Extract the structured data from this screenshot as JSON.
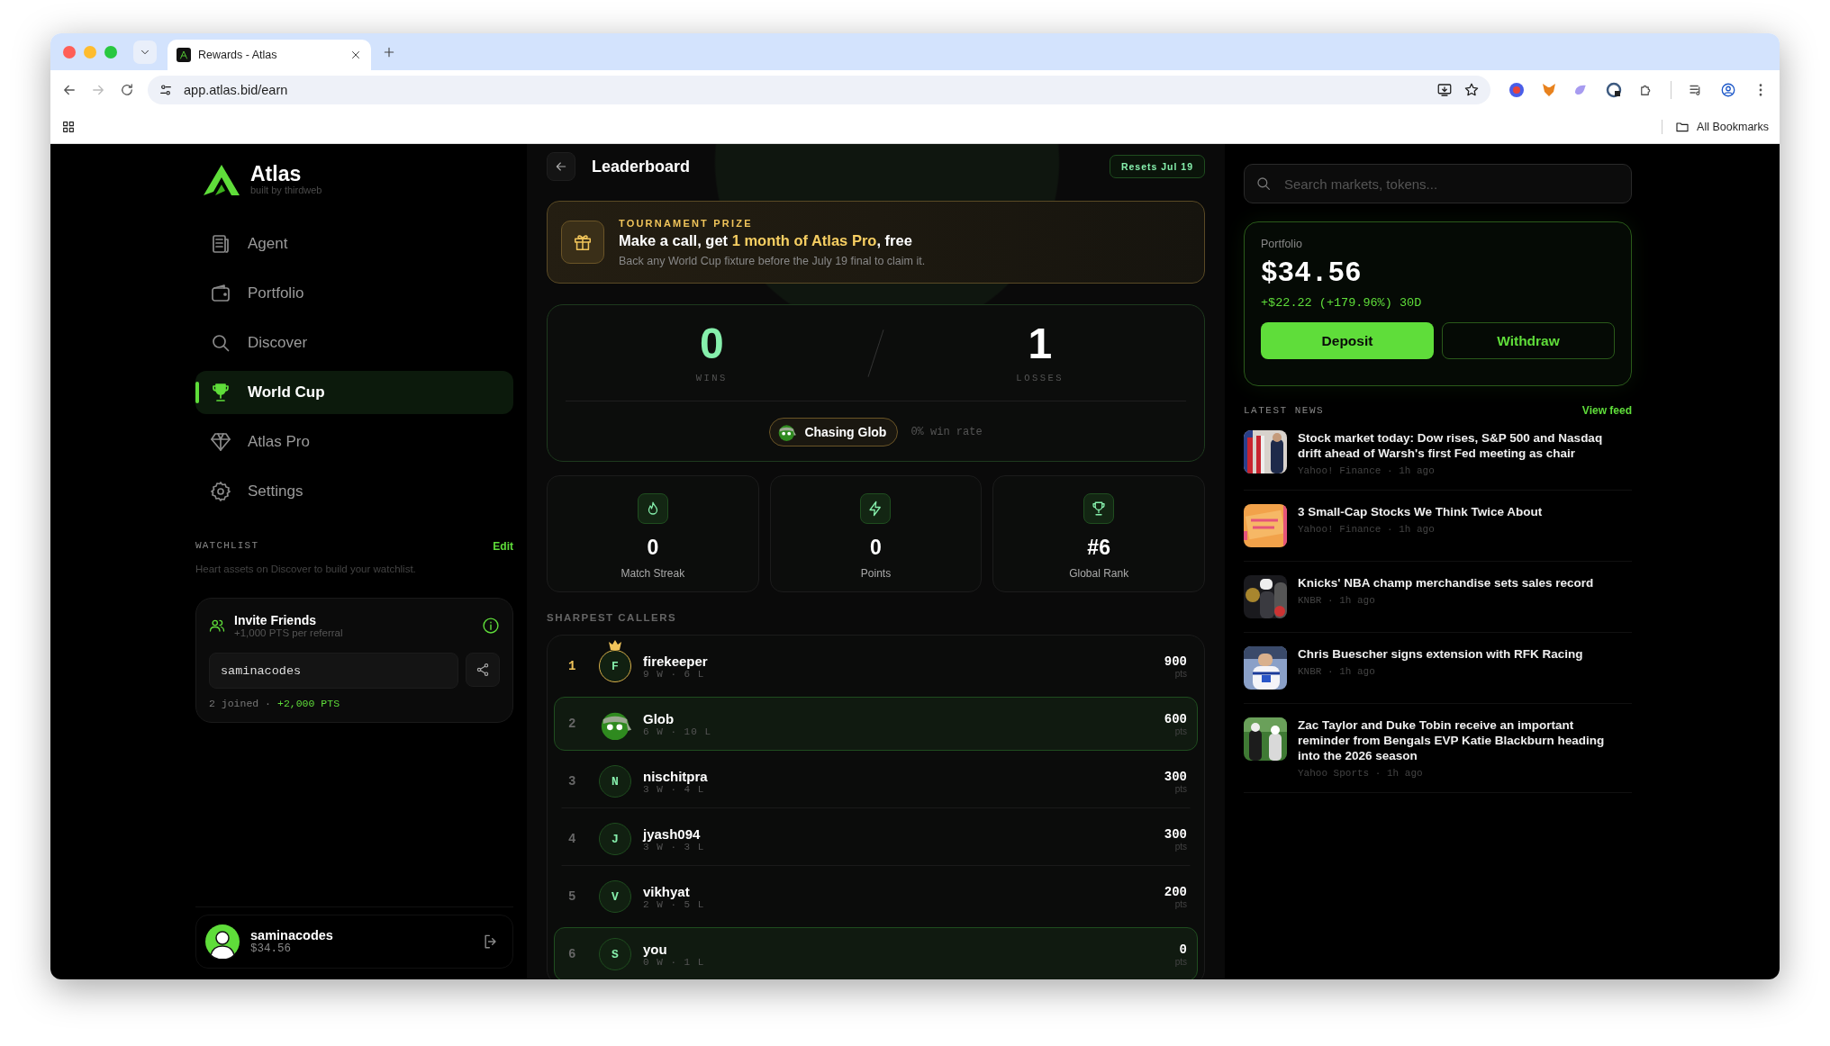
{
  "browser": {
    "tab_title": "Rewards - Atlas",
    "url": "app.atlas.bid/earn",
    "bookmarks": "All Bookmarks"
  },
  "sidebar": {
    "brand": {
      "name": "Atlas",
      "tagline": "built by thirdweb"
    },
    "nav": [
      {
        "label": "Agent",
        "kind": "agent",
        "selected": false
      },
      {
        "label": "Portfolio",
        "kind": "wallet",
        "selected": false
      },
      {
        "label": "Discover",
        "kind": "search",
        "selected": false
      },
      {
        "label": "World Cup",
        "kind": "trophy",
        "selected": true
      },
      {
        "label": "Atlas Pro",
        "kind": "diamond",
        "selected": false
      },
      {
        "label": "Settings",
        "kind": "settings",
        "selected": false
      }
    ],
    "watchlist": {
      "title": "WATCHLIST",
      "action": "Edit",
      "empty_text": "Heart assets on Discover to build your watchlist."
    },
    "invite": {
      "title": "Invite Friends",
      "subtitle": "+1,000 PTS per referral",
      "code": "saminacodes",
      "joined": "2 joined ·",
      "bonus": "+2,000 PTS"
    },
    "user": {
      "name": "saminacodes",
      "balance": "$34.56"
    }
  },
  "leaderboard": {
    "title": "Leaderboard",
    "resets": "Resets Jul 19",
    "prize": {
      "eyebrow": "TOURNAMENT PRIZE",
      "headline": "Make a call, get **1 month of Atlas Pro**, free",
      "note": "Back any World Cup fixture before the July 19 final to claim it."
    },
    "record": {
      "wins": "0",
      "wins_label": "WINS",
      "losses": "1",
      "losses_label": "LOSSES",
      "chasing": "Chasing Glob",
      "win_rate": "0% win rate"
    },
    "stats": [
      {
        "kind": "streak",
        "value": "0",
        "label": "Match Streak"
      },
      {
        "kind": "points",
        "value": "0",
        "label": "Points"
      },
      {
        "kind": "rank",
        "value": "#6",
        "label": "Global Rank"
      }
    ],
    "callers_title": "SHARPEST CALLERS",
    "callers": [
      {
        "rank": "1",
        "kind": "leader",
        "initial": "F",
        "name": "firekeeper",
        "record": "9 W · 6 L",
        "points": "900",
        "unit": "pts",
        "highlighted": false
      },
      {
        "rank": "2",
        "kind": "mascot",
        "name": "Glob",
        "record": "6 W · 10 L",
        "points": "600",
        "unit": "pts",
        "highlighted": true
      },
      {
        "rank": "3",
        "kind": "letter",
        "initial": "N",
        "name": "nischitpra",
        "record": "3 W · 4 L",
        "points": "300",
        "unit": "pts",
        "highlighted": false
      },
      {
        "rank": "4",
        "kind": "letter",
        "initial": "J",
        "name": "jyash094",
        "record": "3 W · 3 L",
        "points": "300",
        "unit": "pts",
        "highlighted": false
      },
      {
        "rank": "5",
        "kind": "letter",
        "initial": "V",
        "name": "vikhyat",
        "record": "2 W · 5 L",
        "points": "200",
        "unit": "pts",
        "highlighted": false
      },
      {
        "rank": "6",
        "kind": "letter",
        "initial": "S",
        "name": "you",
        "record": "0 W · 1 L",
        "points": "0",
        "unit": "pts",
        "highlighted": true
      }
    ]
  },
  "right": {
    "search": {
      "placeholder": "Search markets, tokens..."
    },
    "portfolio": {
      "label": "Portfolio",
      "value": "$34.56",
      "change": "+$22.22 (+179.96%) 30D",
      "deposit": "Deposit",
      "withdraw": "Withdraw"
    },
    "news": {
      "title": "LATEST NEWS",
      "action": "View feed",
      "items": [
        {
          "headline": "Stock market today: Dow rises, S&P 500 and Nasdaq drift ahead of Warsh's first Fed meeting as chair",
          "meta": "Yahoo! Finance · 1h ago"
        },
        {
          "headline": "3 Small-Cap Stocks We Think Twice About",
          "meta": "Yahoo! Finance · 1h ago"
        },
        {
          "headline": "Knicks' NBA champ merchandise sets sales record",
          "meta": "KNBR · 1h ago"
        },
        {
          "headline": "Chris Buescher signs extension with RFK Racing",
          "meta": "KNBR · 1h ago"
        },
        {
          "headline": "Zac Taylor and Duke Tobin receive an important reminder from Bengals EVP Katie Blackburn heading into the 2026 season",
          "meta": "Yahoo Sports · 1h ago"
        }
      ]
    }
  }
}
